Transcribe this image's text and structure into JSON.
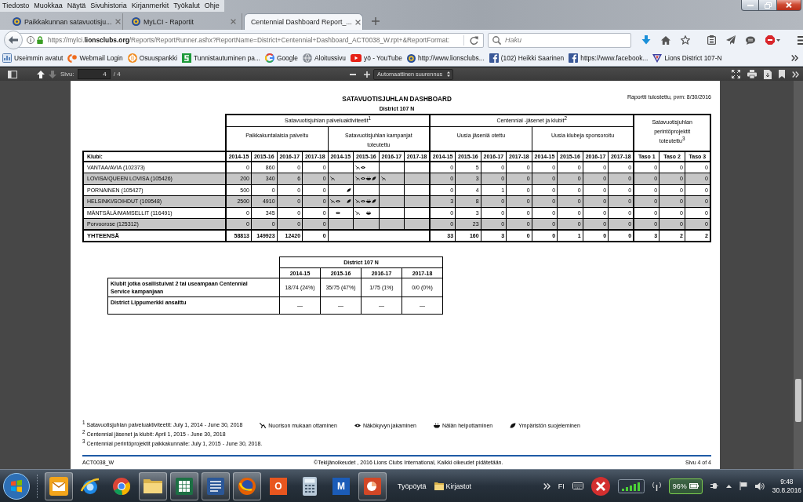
{
  "menu_bar": {
    "items": [
      "Tiedosto",
      "Muokkaa",
      "Näytä",
      "Sivuhistoria",
      "Kirjanmerkit",
      "Työkalut",
      "Ohje"
    ]
  },
  "tabs": [
    {
      "label": "Paikkakunnan satavuotisju...",
      "kind": "site",
      "selected": false
    },
    {
      "label": "MyLCI - Raportit",
      "kind": "site",
      "selected": false
    },
    {
      "label": "Centennial Dashboard Report_...",
      "kind": "document",
      "selected": true
    }
  ],
  "address_bar": {
    "url": "https://mylci.**lionsclubs.org**/Reports/ReportRunner.ashx?ReportName=District+Centennial+Dashboard_ACT0038_W.rpt+&ReportFormat:"
  },
  "search": {
    "placeholder": "Haku"
  },
  "bookmarks": [
    {
      "label": "Useimmin avatut",
      "kind": "frequent"
    },
    {
      "label": "Webmail Login",
      "kind": "webmail"
    },
    {
      "label": "Osuuspankki",
      "kind": "bank"
    },
    {
      "label": "Tunnistautuminen pa...",
      "kind": "identity"
    },
    {
      "label": "Google",
      "kind": "google"
    },
    {
      "label": "Aloitussivu",
      "kind": "globe"
    },
    {
      "label": "yö - YouTube",
      "kind": "video"
    },
    {
      "label": "http://www.lionsclubs...",
      "kind": "lions"
    },
    {
      "label": "(102) Heikki Saarinen",
      "kind": "facebook"
    },
    {
      "label": "https://www.facebook...",
      "kind": "facebook"
    },
    {
      "label": "Lions District 107-N",
      "kind": "district"
    }
  ],
  "pdf_toolbar": {
    "nav_buttons": [
      {
        "kind": "previous",
        "disabled": false
      },
      {
        "kind": "next",
        "disabled": true
      }
    ],
    "page_label": "Sivu:",
    "page": "4",
    "page_count": "/ 4",
    "zoom": "Automaattinen suurennus"
  },
  "report": {
    "title": "SATAVUOTISJUHLAN DASHBOARD",
    "printed_date": "Raportti tulostettu, pvm: 8/30/2016",
    "subtitle": "District 107 N",
    "table": {
      "first_column": "Klubi:",
      "groups": [
        {
          "label": "Satavuotisjuhlan palveluaktiviteetit$^{1}$",
          "subgroups": [
            {
              "label": "Paikkakuntalaisia palveltu",
              "kind": "numbers",
              "columns": [
                "2014-15",
                "2015-16",
                "2016-17",
                "2017-18"
              ]
            },
            {
              "label": "Satavuotisjuhlan kampanjat toteutettu",
              "kind": "campaigns",
              "columns": [
                "2014-15",
                "2015-16",
                "2016-17",
                "2017-18"
              ]
            }
          ]
        },
        {
          "label": "Centennial -jäsenet ja klubit$^{2}$",
          "subgroups": [
            {
              "label": "Uusia jäseniä otettu",
              "kind": "numbers",
              "columns": [
                "2014-15",
                "2015-16",
                "2016-17",
                "2017-18"
              ]
            },
            {
              "label": "Uusia klubeja sponsoroitu",
              "kind": "numbers",
              "columns": [
                "2014-15",
                "2015-16",
                "2016-17",
                "2017-18"
              ]
            }
          ]
        },
        {
          "label": "Satavuotisjuhlan perintöprojektit toteutettu$^{3}$",
          "subgroups": [
            {
              "kind": "numbers",
              "columns": [
                "Taso 1",
                "Taso 2",
                "Taso 3"
              ]
            }
          ]
        }
      ],
      "rows": [
        {
          "club": "VANTAA/AVIA (102373)",
          "cells": [
            [
              "0",
              "860",
              "0",
              "0"
            ],
            [
              null,
              [
                {
                  "kind": "youth"
                },
                {
                  "kind": "vision"
                }
              ],
              null,
              null
            ],
            [
              "0",
              "5",
              "0",
              "0"
            ],
            [
              "0",
              "0",
              "0",
              "0"
            ],
            [
              "0",
              "0",
              "0"
            ]
          ]
        },
        {
          "club": "LOVISA/QUEEN LOVISA (105426)",
          "cells": [
            [
              "200",
              "340",
              "6",
              "0"
            ],
            [
              [
                {
                  "kind": "youth"
                }
              ],
              [
                {
                  "kind": "youth"
                },
                {
                  "kind": "vision"
                },
                {
                  "kind": "hunger"
                },
                {
                  "kind": "environment"
                }
              ],
              [
                {
                  "kind": "youth"
                }
              ],
              null
            ],
            [
              "0",
              "3",
              "0",
              "0"
            ],
            [
              "0",
              "0",
              "0",
              "0"
            ],
            [
              "0",
              "0",
              "0"
            ]
          ]
        },
        {
          "club": "PORNAINEN (105427)",
          "cells": [
            [
              "500",
              "0",
              "0",
              "0"
            ],
            [
              [
                {
                  "kind": "environment"
                }
              ],
              null,
              null,
              null
            ],
            [
              "0",
              "4",
              "1",
              "0"
            ],
            [
              "0",
              "0",
              "0",
              "0"
            ],
            [
              "0",
              "0",
              "0"
            ]
          ]
        },
        {
          "club": "HELSINKI/SOIHDUT (109548)",
          "cells": [
            [
              "2500",
              "4910",
              "0",
              "0"
            ],
            [
              [
                {
                  "kind": "youth"
                },
                {
                  "kind": "vision"
                },
                {
                  "kind": "environment"
                }
              ],
              [
                {
                  "kind": "youth"
                },
                {
                  "kind": "vision"
                },
                {
                  "kind": "hunger"
                },
                {
                  "kind": "environment"
                }
              ],
              null,
              null
            ],
            [
              "3",
              "8",
              "0",
              "0"
            ],
            [
              "0",
              "0",
              "0",
              "0"
            ],
            [
              "0",
              "0",
              "0"
            ]
          ]
        },
        {
          "club": "MÄNTSÄLÄ/MAMSELLIT (116491)",
          "cells": [
            [
              "0",
              "345",
              "0",
              "0"
            ],
            [
              [
                {
                  "kind": "vision"
                }
              ],
              [
                {
                  "kind": "youth"
                },
                {
                  "kind": "hunger"
                }
              ],
              null,
              null
            ],
            [
              "0",
              "3",
              "0",
              "0"
            ],
            [
              "0",
              "0",
              "0",
              "0"
            ],
            [
              "0",
              "0",
              "0"
            ]
          ]
        },
        {
          "club": "Porvoorose (125312)",
          "cells": [
            [
              "0",
              "0",
              "0",
              "0"
            ],
            [
              null,
              null,
              null,
              null
            ],
            [
              "0",
              "23",
              "0",
              "0"
            ],
            [
              "0",
              "0",
              "0",
              "0"
            ],
            [
              "0",
              "0",
              "0"
            ]
          ]
        }
      ],
      "total": {
        "label": "YHTEENSÄ",
        "cells": [
          [
            "58813",
            "149923",
            "12420",
            "0"
          ],
          null,
          [
            "33",
            "160",
            "3",
            "0"
          ],
          [
            "0",
            "1",
            "0",
            "0"
          ],
          [
            "3",
            "2",
            "2"
          ]
        ]
      }
    },
    "summary": {
      "title": "District 107 N",
      "columns": [
        "2014-15",
        "2015-16",
        "2016-17",
        "2017-18"
      ],
      "rows": [
        {
          "label": "Klubit jotka osallistuivat 2 tai useampaan Centennial Service kampanjaan",
          "values": [
            "18/74 (24%)",
            "35/75 (47%)",
            "1/75 (1%)",
            "0/0 (0%)"
          ]
        },
        {
          "label": "District Lippumerkki ansaittu",
          "values": [
            "—",
            "—",
            "—",
            "—"
          ]
        }
      ]
    },
    "footnotes": [
      "$^{1}$ Satavuotisjuhlan palveluaktiviteetit: July 1, 2014 - June 30, 2018",
      "$^{2}$ Centennial jäsenet ja klubit: April 1, 2015 - June 30, 2018",
      "$^{3}$ Centennial perintöprojektit paikkakunnalle: July 1, 2015 - June 30, 2018."
    ],
    "legend": [
      {
        "kind": "youth",
        "label": "Nuorison mukaan ottaminen"
      },
      {
        "kind": "vision",
        "label": "Näkökyvyn jakaminen"
      },
      {
        "kind": "hunger",
        "label": "Nälän helpottaminen"
      },
      {
        "kind": "environment",
        "label": "Ympäristön suojeleminen"
      }
    ],
    "footer": {
      "code": "ACT0038_W",
      "copyright": "©Tekijänoikeudet , 2016 Lions Clubs International, Kaikki oikeudet pidätetään.",
      "page": "Sivu 4 of 4"
    }
  },
  "taskbar": {
    "apps": [
      {
        "kind": "mail",
        "running": true
      },
      {
        "kind": "ie",
        "running": false
      },
      {
        "kind": "chrome",
        "running": false
      },
      {
        "kind": "files",
        "running": true
      },
      {
        "kind": "excel",
        "running": true
      },
      {
        "kind": "word",
        "running": true
      },
      {
        "kind": "firefox",
        "running": true
      },
      {
        "kind": "tile",
        "glyph": "O",
        "color": "#e8561f",
        "running": false
      },
      {
        "kind": "calculator",
        "running": false
      },
      {
        "kind": "tile",
        "glyph": "M",
        "color": "#1b5cb8",
        "running": false
      },
      {
        "kind": "powerpoint",
        "running": true
      }
    ],
    "toolbars": [
      {
        "label": "Työpöytä",
        "kind": "text"
      },
      {
        "label": "Kirjastot",
        "kind": "folder"
      }
    ],
    "language": "FI",
    "battery": "96%",
    "time": "9:48",
    "date": "30.8.2016"
  }
}
